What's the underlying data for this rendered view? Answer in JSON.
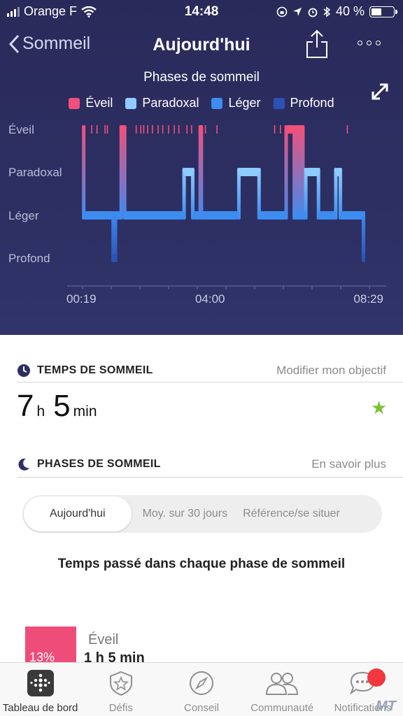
{
  "status_bar": {
    "carrier": "Orange F",
    "time": "14:48",
    "battery_level": "40 %"
  },
  "nav": {
    "back_label": "Sommeil",
    "title": "Aujourd'hui"
  },
  "chart_data": {
    "type": "area",
    "title": "Phases de sommeil",
    "legend": [
      "Éveil",
      "Paradoxal",
      "Léger",
      "Profond"
    ],
    "colors": {
      "Éveil": "#f2507a",
      "Paradoxal": "#8ecbff",
      "Léger": "#3d8cf0",
      "Profond": "#2c52b5"
    },
    "stages": [
      "Éveil",
      "Paradoxal",
      "Léger",
      "Profond"
    ],
    "x_ticks": [
      "00:19",
      "04:00",
      "08:29"
    ],
    "start": "00:19",
    "end": "08:29",
    "segments": [
      [
        "Éveil",
        "00:19",
        "00:21"
      ],
      [
        "Léger",
        "00:21",
        "01:12"
      ],
      [
        "Profond",
        "01:12",
        "01:16"
      ],
      [
        "Léger",
        "01:16",
        "01:26"
      ],
      [
        "Éveil",
        "01:26",
        "01:32"
      ],
      [
        "Léger",
        "01:32",
        "03:15"
      ],
      [
        "Paradoxal",
        "03:15",
        "03:30"
      ],
      [
        "Léger",
        "03:30",
        "03:43"
      ],
      [
        "Éveil",
        "03:43",
        "03:45"
      ],
      [
        "Léger",
        "03:45",
        "04:50"
      ],
      [
        "Paradoxal",
        "04:50",
        "05:25"
      ],
      [
        "Léger",
        "05:25",
        "06:12"
      ],
      [
        "Éveil",
        "06:12",
        "06:26"
      ],
      [
        "Léger",
        "06:26",
        "06:31"
      ],
      [
        "Éveil",
        "06:31",
        "06:34"
      ],
      [
        "Léger",
        "06:34",
        "06:38"
      ],
      [
        "Éveil",
        "06:38",
        "06:41"
      ],
      [
        "Léger",
        "06:41",
        "06:46"
      ],
      [
        "Paradoxal",
        "06:46",
        "07:08"
      ],
      [
        "Léger",
        "07:08",
        "07:38"
      ],
      [
        "Paradoxal",
        "07:38",
        "07:46"
      ],
      [
        "Léger",
        "07:46",
        "08:26"
      ],
      [
        "Profond",
        "08:26",
        "08:29"
      ]
    ],
    "awake_ticks": [
      "00:35",
      "00:44",
      "00:58",
      "01:02",
      "01:52",
      "02:00",
      "02:05",
      "02:12",
      "02:20",
      "02:30",
      "02:38",
      "02:48",
      "02:58",
      "03:06",
      "03:20",
      "03:28",
      "03:52",
      "04:12",
      "05:52",
      "06:02",
      "07:58"
    ]
  },
  "sleep_time": {
    "heading": "TEMPS DE SOMMEIL",
    "link": "Modifier mon objectif",
    "hours": "7",
    "hours_unit": "h",
    "minutes": "5",
    "minutes_unit": "min"
  },
  "sleep_phases": {
    "heading": "PHASES DE SOMMEIL",
    "link": "En savoir plus",
    "tabs": [
      "Aujourd'hui",
      "Moy. sur 30 jours",
      "Référence/se situer"
    ],
    "selected_tab": "Aujourd'hui",
    "subtitle": "Temps passé dans chaque phase de sommeil",
    "first_phase": {
      "percent": "13%",
      "label": "Éveil",
      "duration": "1 h 5 min"
    }
  },
  "tab_bar": {
    "items": [
      "Tableau de bord",
      "Défis",
      "Conseil",
      "Communauté",
      "Notifications"
    ],
    "active": "Tableau de bord",
    "notification_badge": "red-dot"
  },
  "watermark": "MT"
}
